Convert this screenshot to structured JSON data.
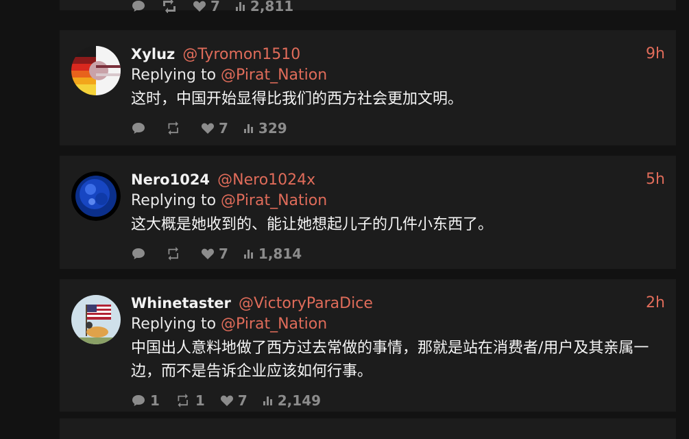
{
  "top_card": {
    "likes": "7",
    "views": "2,811"
  },
  "tweets": [
    {
      "name": "Xyluz",
      "handle": "@Tyromon1510",
      "time": "9h",
      "reply_prefix": "Replying to",
      "reply_to": "@Pirat_Nation",
      "text": "这时，中国开始显得比我们的西方社会更加文明。",
      "replies": "",
      "retweets": "",
      "likes": "7",
      "views": "329"
    },
    {
      "name": "Nero1024",
      "handle": "@Nero1024x",
      "time": "5h",
      "reply_prefix": "Replying to",
      "reply_to": "@Pirat_Nation",
      "text": "这大概是她收到的、能让她想起儿子的几件小东西了。",
      "replies": "",
      "retweets": "",
      "likes": "7",
      "views": "1,814"
    },
    {
      "name": "Whinetaster",
      "handle": "@VictoryParaDice",
      "time": "2h",
      "reply_prefix": "Replying to",
      "reply_to": "@Pirat_Nation",
      "text": "中国出人意料地做了西方过去常做的事情，那就是站在消费者/用户及其亲属一边，而不是告诉企业应该如何行事。",
      "replies": "1",
      "retweets": "1",
      "likes": "7",
      "views": "2,149"
    }
  ],
  "colors": {
    "accent": "#e06c5a",
    "card_bg": "#1c1c1c",
    "page_bg": "#121212",
    "muted": "#8c8c8c"
  },
  "icons": [
    "reply-icon",
    "retweet-icon",
    "heart-icon",
    "views-icon"
  ]
}
